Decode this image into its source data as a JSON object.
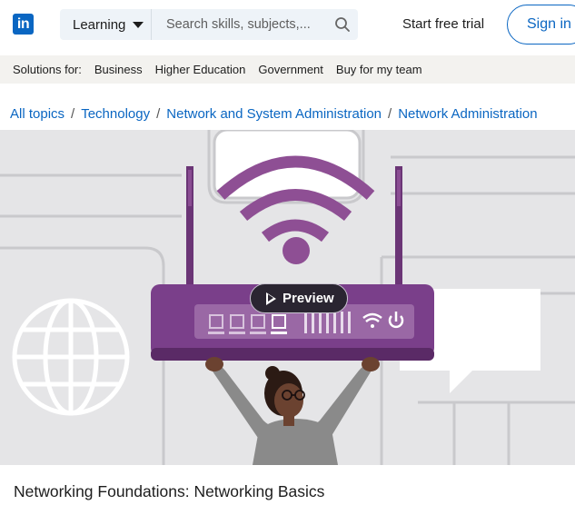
{
  "header": {
    "logo_text": "in",
    "product_label": "Learning",
    "search_placeholder": "Search skills, subjects,...",
    "start_trial": "Start free trial",
    "sign_in": "Sign in"
  },
  "subnav": {
    "items": [
      "Solutions for:",
      "Business",
      "Higher Education",
      "Government",
      "Buy for my team"
    ]
  },
  "breadcrumb": [
    "All topics",
    "Technology",
    "Network and System Administration",
    "Network Administration"
  ],
  "hero": {
    "preview_label": "Preview",
    "accent_color": "#7a3f8a"
  },
  "course": {
    "title": "Networking Foundations: Networking Basics"
  },
  "colors": {
    "brand": "#0a66c2"
  },
  "icons": [
    "search-icon",
    "chevron-down-icon",
    "play-icon",
    "globe-icon",
    "wifi-icon",
    "power-icon",
    "chat-bubble-icon"
  ]
}
